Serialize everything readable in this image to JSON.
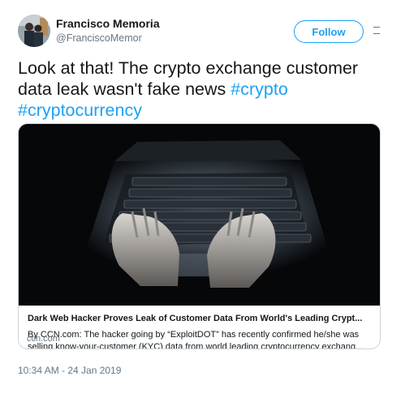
{
  "author": {
    "name": "Francisco Memoria",
    "handle": "@FranciscoMemor"
  },
  "follow_label": "Follow",
  "tweet": {
    "text_before": "Look at that! The crypto exchange customer data leak wasn't fake news ",
    "hashtag1": "#crypto",
    "hashtag2": "#cryptocurrency"
  },
  "card": {
    "title": "Dark Web Hacker Proves Leak of Customer Data From World's Leading Crypt...",
    "description": "By CCN.com: The hacker going by “ExploitDOT” has recently confirmed he/she was selling know-your-customer (KYC) data from world leading cryptocurrency exchang...",
    "domain": "ccn.com"
  },
  "timestamp": "10:34 AM - 24 Jan 2019",
  "colors": {
    "accent": "#1da1f2",
    "secondary_text": "#657786"
  }
}
